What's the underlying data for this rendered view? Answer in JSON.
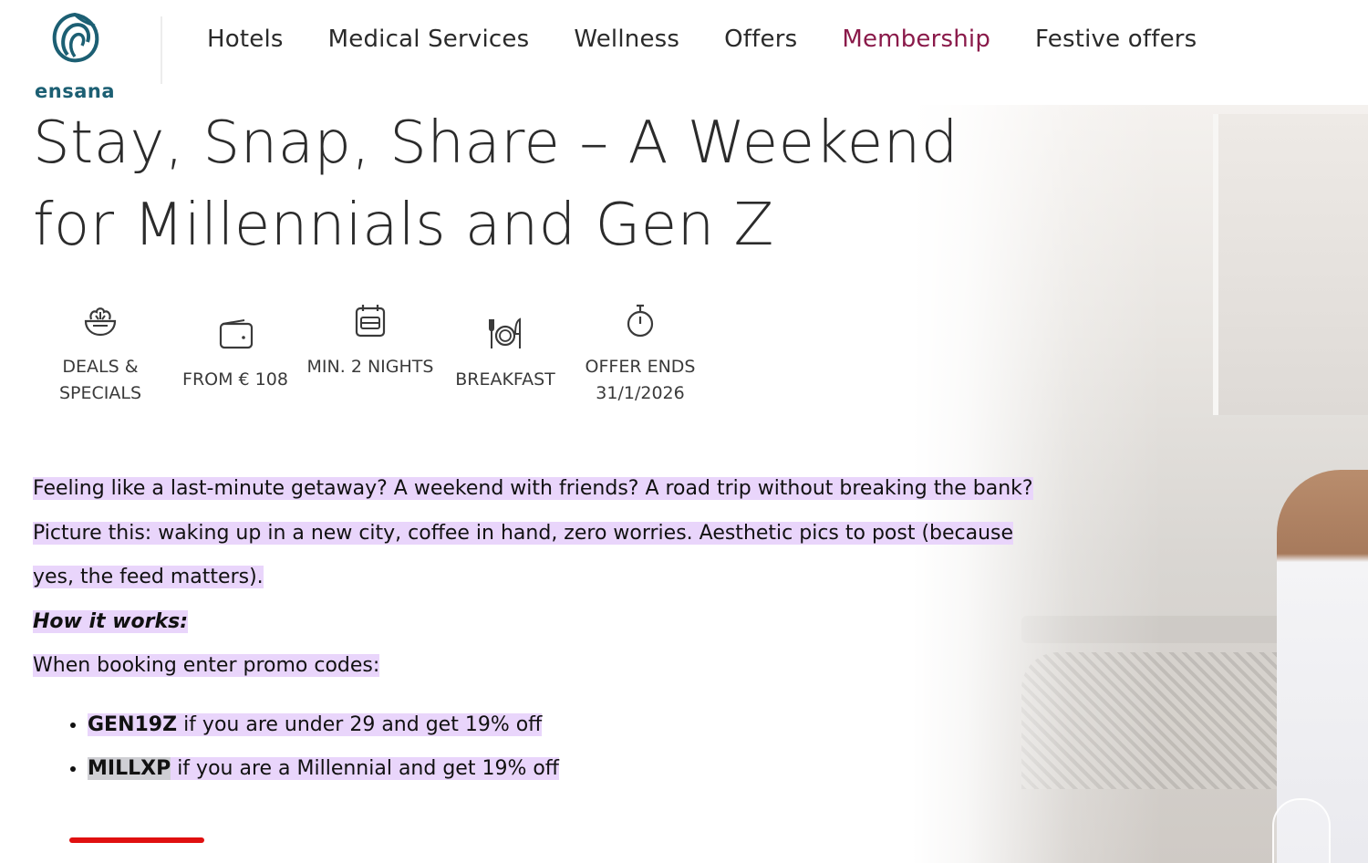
{
  "brand": {
    "logo_text": "ensana",
    "accent": "#8a1a4a",
    "logo_color": "#1c5f73"
  },
  "nav": {
    "items": [
      {
        "label": "Hotels"
      },
      {
        "label": "Medical Services"
      },
      {
        "label": "Wellness"
      },
      {
        "label": "Offers"
      },
      {
        "label": "Membership",
        "active": true
      },
      {
        "label": "Festive offers"
      }
    ]
  },
  "title": "Stay, Snap, Share – A Weekend for Millennials and Gen Z",
  "features": [
    {
      "icon": "deals-bowl-icon",
      "label": "DEALS & SPECIALS"
    },
    {
      "icon": "wallet-icon",
      "label": "FROM € 108"
    },
    {
      "icon": "calendar-icon",
      "label": "MIN. 2 NIGHTS"
    },
    {
      "icon": "breakfast-cutlery-icon",
      "label": "BREAKFAST"
    },
    {
      "icon": "stopwatch-icon",
      "label": "OFFER ENDS 31/1/2026"
    }
  ],
  "body": {
    "para1": "Feeling like a last-minute getaway? A weekend with friends? A road trip without breaking the bank?",
    "para2": "Picture this: waking up in a new city, coffee in hand, zero worries. Aesthetic pics to post (because yes, the feed matters).",
    "how_heading": "How it works:",
    "promo_intro": "When booking enter promo codes:",
    "promos": [
      {
        "code": "GEN19Z",
        "text": " if you are under 29 and get 19% off"
      },
      {
        "code": "MILLXP",
        "text": " if you are a Millennial and get 19% off"
      }
    ]
  },
  "colors": {
    "highlight": "#e9d5fb",
    "underline": "#e01010"
  }
}
